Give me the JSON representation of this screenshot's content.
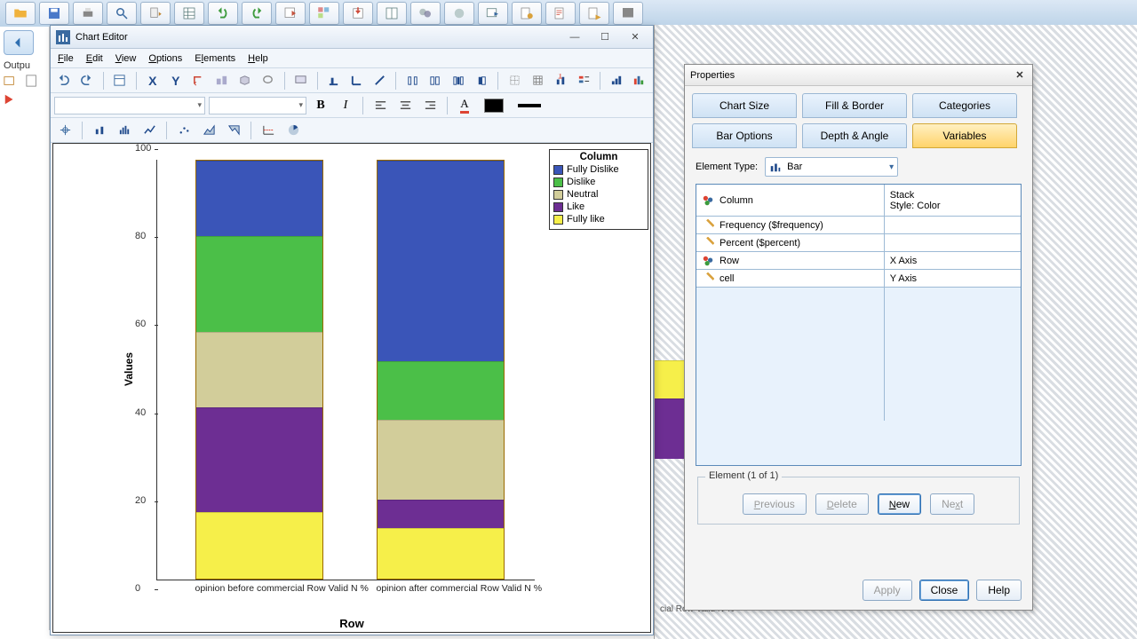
{
  "window": {
    "title": "Chart Editor"
  },
  "menu": {
    "file": "File",
    "edit": "Edit",
    "view": "View",
    "options": "Options",
    "elements": "Elements",
    "help": "Help"
  },
  "output_label": "Outpu",
  "legend": {
    "title": "Column",
    "items": [
      {
        "label": "Fully Dislike",
        "color": "#3a55b8"
      },
      {
        "label": "Dislike",
        "color": "#4bbf48"
      },
      {
        "label": "Neutral",
        "color": "#d2cd9a"
      },
      {
        "label": "Like",
        "color": "#6d2e93"
      },
      {
        "label": "Fully like",
        "color": "#f6ef4a"
      }
    ]
  },
  "axes": {
    "ylabel": "Values",
    "xlabel": "Row",
    "ymin": 0,
    "ymax": 100
  },
  "chart_data": {
    "type": "bar",
    "subtype": "stacked",
    "ylabel": "Values",
    "xlabel": "Row",
    "ylim": [
      0,
      100
    ],
    "categories": [
      "opinion before commercial Row Valid N %",
      "opinion after commercial Row Valid N %"
    ],
    "legend_title": "Column",
    "series": [
      {
        "name": "Fully like",
        "color": "#f6ef4a",
        "values": [
          16,
          12
        ]
      },
      {
        "name": "Like",
        "color": "#6d2e93",
        "values": [
          25,
          7
        ]
      },
      {
        "name": "Neutral",
        "color": "#d2cd9a",
        "values": [
          18,
          19
        ]
      },
      {
        "name": "Dislike",
        "color": "#4bbf48",
        "values": [
          23,
          14
        ]
      },
      {
        "name": "Fully Dislike",
        "color": "#3a55b8",
        "values": [
          18,
          48
        ]
      }
    ]
  },
  "properties": {
    "title": "Properties",
    "tabs": {
      "chart_size": "Chart Size",
      "fill_border": "Fill & Border",
      "categories": "Categories",
      "bar_options": "Bar Options",
      "depth_angle": "Depth & Angle",
      "variables": "Variables"
    },
    "element_type_label": "Element Type:",
    "element_type_value": "Bar",
    "vars": [
      {
        "icon": "cat",
        "name": "Column",
        "right1": "Stack",
        "right2": "Style: Color"
      },
      {
        "icon": "meas",
        "name": "Frequency ($frequency)",
        "right1": "",
        "right2": ""
      },
      {
        "icon": "meas",
        "name": "Percent ($percent)",
        "right1": "",
        "right2": ""
      },
      {
        "icon": "cat",
        "name": "Row",
        "right1": "X Axis",
        "right2": ""
      },
      {
        "icon": "meas",
        "name": "cell",
        "right1": "Y Axis",
        "right2": ""
      }
    ],
    "element_group": "Element (1 of 1)",
    "buttons": {
      "previous": "Previous",
      "delete": "Delete",
      "new": "New",
      "next": "Next",
      "apply": "Apply",
      "close": "Close",
      "help": "Help"
    }
  },
  "bg_caption": "cial Row Valid N %"
}
